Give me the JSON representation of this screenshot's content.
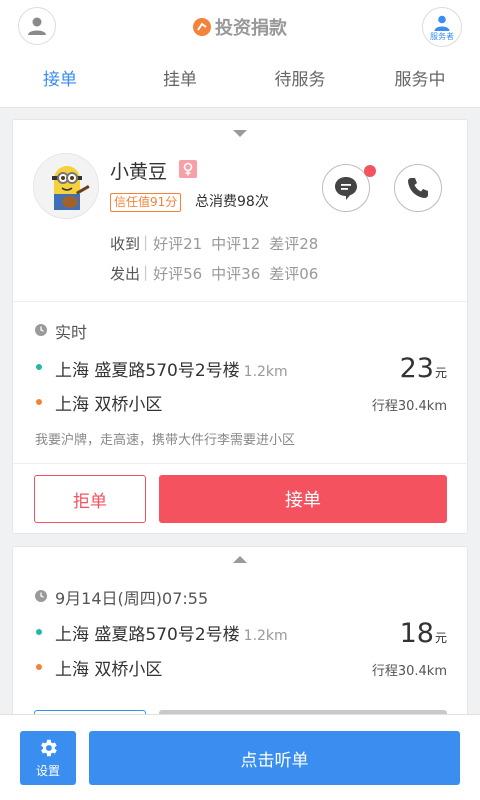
{
  "header": {
    "brand": "投资捐款",
    "service_label": "服务者",
    "colors": {
      "accent": "#3a8ef0",
      "brand": "#f5823a",
      "danger": "#f5525f"
    }
  },
  "tabs": [
    {
      "label": "接单",
      "active": true
    },
    {
      "label": "挂单",
      "active": false
    },
    {
      "label": "待服务",
      "active": false
    },
    {
      "label": "服务中",
      "active": false
    }
  ],
  "card1": {
    "user": {
      "name": "小黄豆",
      "gender_icon": "female-icon",
      "trust": "信任值91分",
      "total": "总消费98次"
    },
    "received": {
      "label": "收到",
      "good": "好评21",
      "mid": "中评12",
      "bad": "差评28"
    },
    "sent": {
      "label": "发出",
      "good": "好评56",
      "mid": "中评36",
      "bad": "差评06"
    },
    "time": "实时",
    "from": {
      "place": "上海 盛夏路570号2号楼",
      "distance": "1.2km"
    },
    "to": {
      "place": "上海 双桥小区"
    },
    "price": "23",
    "price_unit": "元",
    "trip": "行程30.4km",
    "note": "我要沪牌，走高速，携带大件行李需要进小区",
    "reject_label": "拒单",
    "accept_label": "接单"
  },
  "card2": {
    "time": "9月14日(周四)07:55",
    "from": {
      "place": "上海 盛夏路570号2号楼",
      "distance": "1.2km"
    },
    "to": {
      "place": "上海 双桥小区"
    },
    "price": "18",
    "price_unit": "元",
    "trip": "行程30.4km"
  },
  "bottom": {
    "settings_label": "设置",
    "listen_label": "点击听单"
  }
}
